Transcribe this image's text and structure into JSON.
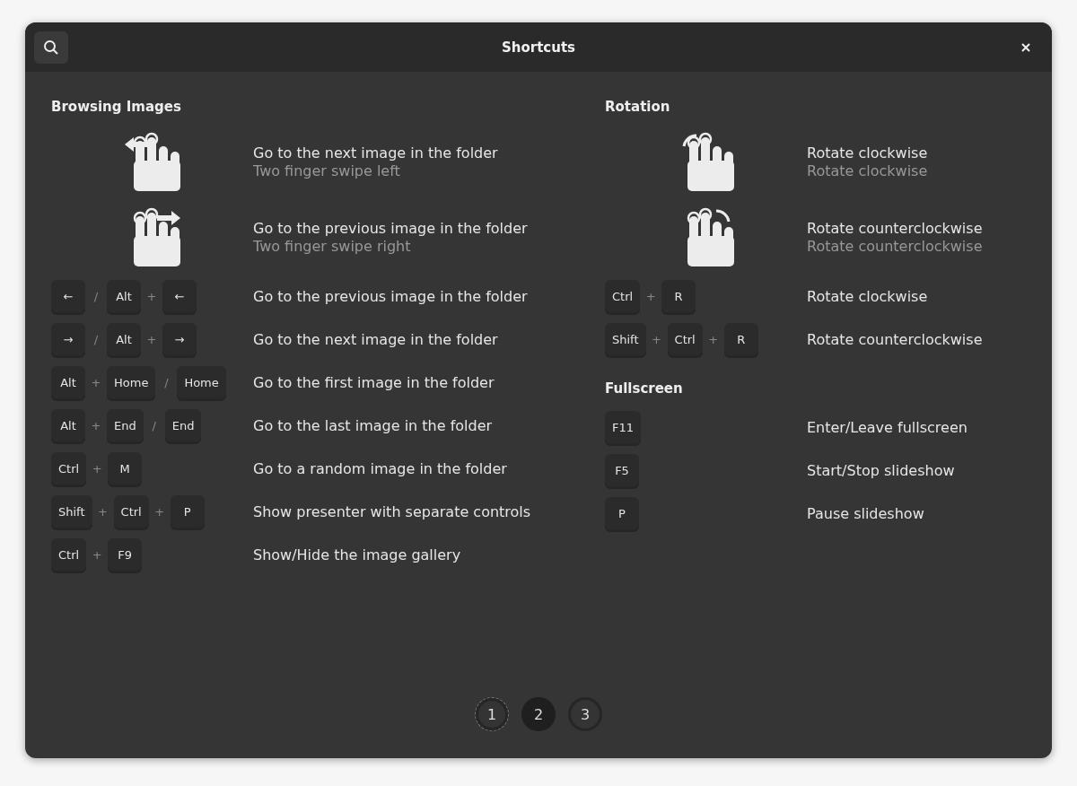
{
  "window": {
    "title": "Shortcuts"
  },
  "columns": [
    {
      "sections": [
        {
          "title": "Browsing Images",
          "rows": [
            {
              "kind": "swipe-left",
              "title": "Go to the next image in the folder",
              "subtitle": "Two finger swipe left"
            },
            {
              "kind": "swipe-right",
              "title": "Go to the previous image in the folder",
              "subtitle": "Two finger swipe right"
            },
            {
              "kind": "keys",
              "keys": [
                {
                  "kind": "key",
                  "text": "←"
                },
                {
                  "kind": "sep",
                  "text": "/"
                },
                {
                  "kind": "key",
                  "text": "Alt"
                },
                {
                  "kind": "sep",
                  "text": "+"
                },
                {
                  "kind": "key",
                  "text": "←"
                }
              ],
              "title": "Go to the previous image in the folder"
            },
            {
              "kind": "keys",
              "keys": [
                {
                  "kind": "key",
                  "text": "→"
                },
                {
                  "kind": "sep",
                  "text": "/"
                },
                {
                  "kind": "key",
                  "text": "Alt"
                },
                {
                  "kind": "sep",
                  "text": "+"
                },
                {
                  "kind": "key",
                  "text": "→"
                }
              ],
              "title": "Go to the next image in the folder"
            },
            {
              "kind": "keys",
              "keys": [
                {
                  "kind": "key",
                  "text": "Alt"
                },
                {
                  "kind": "sep",
                  "text": "+"
                },
                {
                  "kind": "key",
                  "text": "Home"
                },
                {
                  "kind": "sep",
                  "text": "/"
                },
                {
                  "kind": "key",
                  "text": "Home"
                }
              ],
              "title": "Go to the first image in the folder"
            },
            {
              "kind": "keys",
              "keys": [
                {
                  "kind": "key",
                  "text": "Alt"
                },
                {
                  "kind": "sep",
                  "text": "+"
                },
                {
                  "kind": "key",
                  "text": "End"
                },
                {
                  "kind": "sep",
                  "text": "/"
                },
                {
                  "kind": "key",
                  "text": "End"
                }
              ],
              "title": "Go to the last image in the folder"
            },
            {
              "kind": "keys",
              "keys": [
                {
                  "kind": "key",
                  "text": "Ctrl"
                },
                {
                  "kind": "sep",
                  "text": "+"
                },
                {
                  "kind": "key",
                  "text": "M"
                }
              ],
              "title": "Go to a random image in the folder"
            },
            {
              "kind": "keys",
              "keys": [
                {
                  "kind": "key",
                  "text": "Shift"
                },
                {
                  "kind": "sep",
                  "text": "+"
                },
                {
                  "kind": "key",
                  "text": "Ctrl"
                },
                {
                  "kind": "sep",
                  "text": "+"
                },
                {
                  "kind": "key",
                  "text": "P"
                }
              ],
              "title": "Show presenter with separate controls"
            },
            {
              "kind": "keys",
              "keys": [
                {
                  "kind": "key",
                  "text": "Ctrl"
                },
                {
                  "kind": "sep",
                  "text": "+"
                },
                {
                  "kind": "key",
                  "text": "F9"
                }
              ],
              "title": "Show/Hide the image gallery"
            }
          ]
        }
      ]
    },
    {
      "sections": [
        {
          "title": "Rotation",
          "rows": [
            {
              "kind": "rotate-clockwise",
              "title": "Rotate clockwise",
              "subtitle": "Rotate clockwise"
            },
            {
              "kind": "rotate-counterclockwise",
              "title": "Rotate counterclockwise",
              "subtitle": "Rotate counterclockwise"
            },
            {
              "kind": "keys",
              "keys": [
                {
                  "kind": "key",
                  "text": "Ctrl"
                },
                {
                  "kind": "sep",
                  "text": "+"
                },
                {
                  "kind": "key",
                  "text": "R"
                }
              ],
              "title": "Rotate clockwise"
            },
            {
              "kind": "keys",
              "keys": [
                {
                  "kind": "key",
                  "text": "Shift"
                },
                {
                  "kind": "sep",
                  "text": "+"
                },
                {
                  "kind": "key",
                  "text": "Ctrl"
                },
                {
                  "kind": "sep",
                  "text": "+"
                },
                {
                  "kind": "key",
                  "text": "R"
                }
              ],
              "title": "Rotate counterclockwise"
            }
          ]
        },
        {
          "title": "Fullscreen",
          "rows": [
            {
              "kind": "keys",
              "keys": [
                {
                  "kind": "key",
                  "text": "F11"
                }
              ],
              "title": "Enter/Leave fullscreen"
            },
            {
              "kind": "keys",
              "keys": [
                {
                  "kind": "key",
                  "text": "F5"
                }
              ],
              "title": "Start/Stop slideshow"
            },
            {
              "kind": "keys",
              "keys": [
                {
                  "kind": "key",
                  "text": "P"
                }
              ],
              "title": "Pause slideshow"
            }
          ]
        }
      ]
    }
  ],
  "pages": [
    {
      "label": "1",
      "selected": false,
      "focused": true
    },
    {
      "label": "2",
      "selected": true,
      "focused": false
    },
    {
      "label": "3",
      "selected": false,
      "focused": false
    }
  ]
}
